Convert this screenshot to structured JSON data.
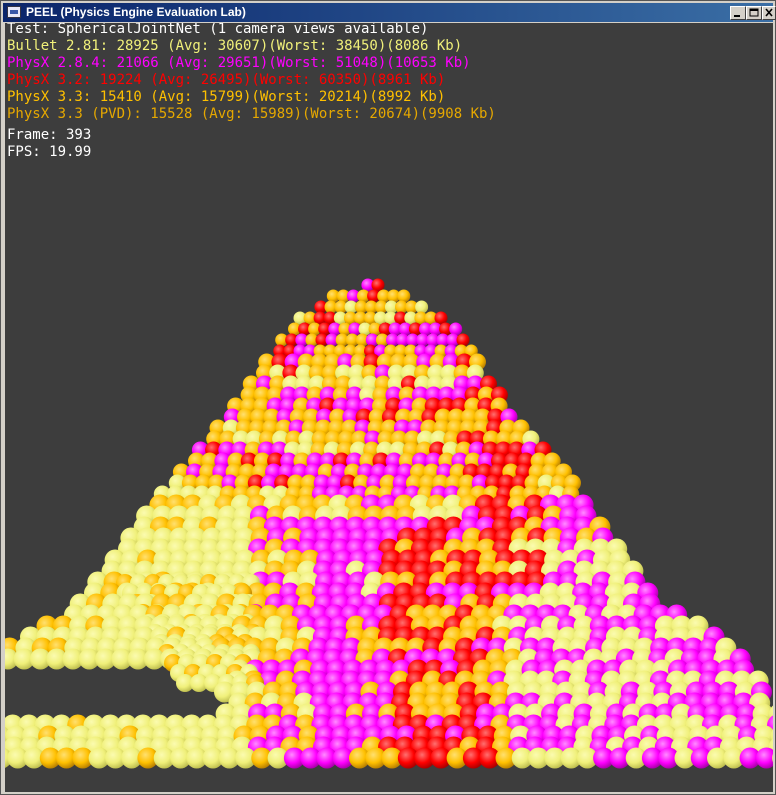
{
  "window": {
    "title": "PEEL (Physics Engine Evaluation Lab)"
  },
  "hud": {
    "test_line": "Test: SphericalJointNet (1 camera views available)",
    "engines": [
      {
        "text": "Bullet 2.81: 28925 (Avg: 30607)(Worst: 38450)(8086 Kb)",
        "color": "#f0f07a"
      },
      {
        "text": "PhysX 2.8.4: 21066 (Avg: 29651)(Worst: 51048)(10653 Kb)",
        "color": "#ff00ff"
      },
      {
        "text": "PhysX 3.2: 19224 (Avg: 26495)(Worst: 60350)(8961 Kb)",
        "color": "#ff0000"
      },
      {
        "text": "PhysX 3.3: 15410 (Avg: 15799)(Worst: 20214)(8992 Kb)",
        "color": "#ffc000"
      },
      {
        "text": "PhysX 3.3 (PVD): 15528 (Avg: 15989)(Worst: 20674)(9908 Kb)",
        "color": "#e6a800"
      }
    ],
    "frame_line": "Frame: 393",
    "fps_line": "FPS: 19.99"
  },
  "colors": {
    "viewport_bg": "#3d3d3d",
    "hud_white": "#ffffff",
    "sphere_yellow": "#f0f07a",
    "sphere_magenta": "#ff00ff",
    "sphere_red": "#ff0000",
    "sphere_orange": "#ffc000"
  }
}
